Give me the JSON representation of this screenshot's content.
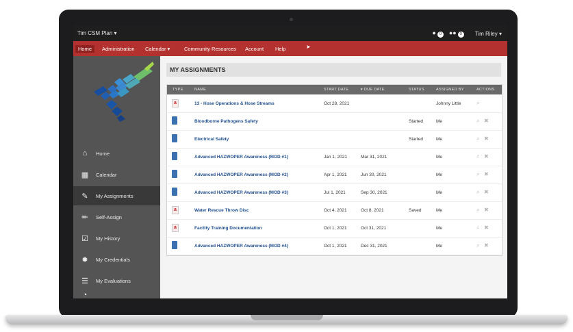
{
  "topbar": {
    "plan_label": "Tim CSM Plan ▾",
    "user_badge": "0",
    "group_badge": "0",
    "user_name": "Tim Riley ▾"
  },
  "nav": {
    "home": "Home",
    "administration": "Administration",
    "calendar": "Calendar ▾",
    "community": "Community Resources",
    "account": "Account",
    "help": "Help"
  },
  "sidebar": {
    "items": [
      {
        "label": "Home",
        "icon": "home-icon"
      },
      {
        "label": "Calendar",
        "icon": "calendar-icon"
      },
      {
        "label": "My Assignments",
        "icon": "edit-icon"
      },
      {
        "label": "Self-Assign",
        "icon": "pencil-icon"
      },
      {
        "label": "My History",
        "icon": "checkbox-icon"
      },
      {
        "label": "My Credentials",
        "icon": "badge-icon"
      },
      {
        "label": "My Evaluations",
        "icon": "checklist-icon"
      }
    ]
  },
  "page": {
    "title": "MY ASSIGNMENTS"
  },
  "table": {
    "headers": {
      "type": "TYPE",
      "name": "NAME",
      "start": "START DATE",
      "due": "▾ DUE DATE",
      "status": "STATUS",
      "assigned_by": "ASSIGNED BY",
      "actions": "ACTIONS"
    },
    "rows": [
      {
        "type": "a",
        "name": "13 - Hose Operations & Hose Streams",
        "start": "Oct 28, 2021",
        "due": "",
        "status": "",
        "assigned_by": "Johnny Little",
        "delete": false
      },
      {
        "type": "book",
        "name": "Bloodborne Pathogens Safety",
        "start": "",
        "due": "",
        "status": "Started",
        "assigned_by": "Me",
        "delete": true
      },
      {
        "type": "book",
        "name": "Electrical Safety",
        "start": "",
        "due": "",
        "status": "Started",
        "assigned_by": "Me",
        "delete": true
      },
      {
        "type": "book",
        "name": "Advanced HAZWOPER Awareness (MOD #1)",
        "start": "Jan 1, 2021",
        "due": "Mar 31, 2021",
        "status": "",
        "assigned_by": "Me",
        "delete": true
      },
      {
        "type": "book",
        "name": "Advanced HAZWOPER Awareness (MOD #2)",
        "start": "Apr 1, 2021",
        "due": "Jun 30, 2021",
        "status": "",
        "assigned_by": "Me",
        "delete": true
      },
      {
        "type": "book",
        "name": "Advanced HAZWOPER Awareness (MOD #3)",
        "start": "Jul 1, 2021",
        "due": "Sep 30, 2021",
        "status": "",
        "assigned_by": "Me",
        "delete": true
      },
      {
        "type": "a",
        "name": "Water Rescue Throw Disc",
        "start": "Oct 4, 2021",
        "due": "Oct 8, 2021",
        "status": "Saved",
        "assigned_by": "Me",
        "delete": true
      },
      {
        "type": "a",
        "name": "Facility Training Documentation",
        "start": "Oct 1, 2021",
        "due": "Oct 31, 2021",
        "status": "",
        "assigned_by": "Me",
        "delete": true
      },
      {
        "type": "book",
        "name": "Advanced HAZWOPER Awareness (MOD #4)",
        "start": "Oct 1, 2021",
        "due": "Dec 31, 2021",
        "status": "",
        "assigned_by": "Me",
        "delete": true
      }
    ]
  },
  "colors": {
    "nav_red": "#b3322f",
    "sidebar": "#545454",
    "link_blue": "#1f4e8c"
  }
}
